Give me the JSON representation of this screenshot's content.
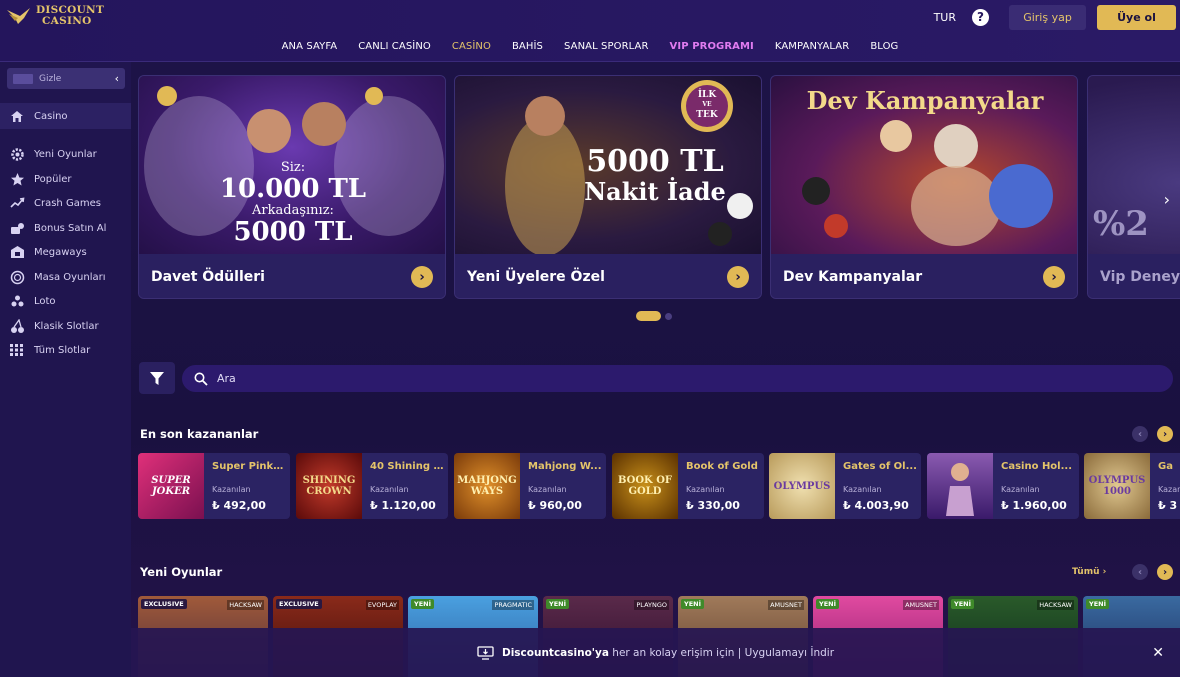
{
  "brand": {
    "line1": "DISCOUNT",
    "line2": "CASINO"
  },
  "header": {
    "lang": "TUR",
    "login": "Giriş yap",
    "register": "Üye ol",
    "nav": [
      "ANA SAYFA",
      "CANLI CASİNO",
      "CASİNO",
      "BAHİS",
      "SANAL SPORLAR",
      "VIP PROGRAMI",
      "KAMPANYALAR",
      "BLOG"
    ]
  },
  "sidebar": {
    "hide_label": "Gizle",
    "items": [
      {
        "label": "Casino",
        "icon": "home-icon"
      },
      {
        "label": "Yeni Oyunlar",
        "icon": "gear-icon"
      },
      {
        "label": "Popüler",
        "icon": "star-icon"
      },
      {
        "label": "Crash Games",
        "icon": "trend-icon"
      },
      {
        "label": "Bonus Satın Al",
        "icon": "bonus-icon"
      },
      {
        "label": "Megaways",
        "icon": "megaways-icon"
      },
      {
        "label": "Masa Oyunları",
        "icon": "table-icon"
      },
      {
        "label": "Loto",
        "icon": "lotto-icon"
      },
      {
        "label": "Klasik Slotlar",
        "icon": "cherry-icon"
      },
      {
        "label": "Tüm Slotlar",
        "icon": "grid-icon"
      }
    ]
  },
  "promos": [
    {
      "title": "Davet Ödülleri",
      "img_line1": "Siz:",
      "img_line2": "10.000 TL",
      "img_line3": "Arkadaşınız:",
      "img_line4": "5000 TL"
    },
    {
      "title": "Yeni Üyelere Özel",
      "img_line1": "5000 TL",
      "img_line2": "Nakit İade",
      "badge1": "İLK",
      "badge2": "VE",
      "badge3": "TEK"
    },
    {
      "title": "Dev Kampanyalar",
      "img_line1": "Dev Kampanyalar"
    },
    {
      "title": "Vip Deneyi",
      "img_line1": "%2"
    }
  ],
  "search": {
    "placeholder": "Ara"
  },
  "winners": {
    "title": "En son kazananlar",
    "label": "Kazanılan",
    "items": [
      {
        "name": "Super Pink ...",
        "amount": "₺ 492,00",
        "thumb": "SUPER JOKER",
        "color": "#c2185b"
      },
      {
        "name": "40 Shining ...",
        "amount": "₺ 1.120,00",
        "thumb": "SHINING CROWN",
        "color": "#8b1a1a"
      },
      {
        "name": "Mahjong W...",
        "amount": "₺ 960,00",
        "thumb": "MAHJONG WAYS",
        "color": "#b8650f"
      },
      {
        "name": "Book of Gold",
        "amount": "₺ 330,00",
        "thumb": "BOOK OF GOLD",
        "color": "#7a4a0a"
      },
      {
        "name": "Gates of Ol...",
        "amount": "₺ 4.003,90",
        "thumb": "OLYMPUS",
        "color": "#d9c28a"
      },
      {
        "name": "Casino Hol...",
        "amount": "₺ 1.960,00",
        "thumb": "",
        "color": "#5b3a7a"
      },
      {
        "name": "Ga",
        "amount": "₺ 3",
        "thumb": "OLYMPUS 1000",
        "color": "#b99a5a"
      }
    ]
  },
  "new_games": {
    "title": "Yeni Oyunlar",
    "all": "Tümü ›",
    "items": [
      {
        "tag": "EXCLUSIVE",
        "provider": "HACKSAW",
        "color": "#7a3a2a"
      },
      {
        "tag": "EXCLUSIVE",
        "provider": "EVOPLAY",
        "color": "#6a1a1a"
      },
      {
        "tag": "YENİ",
        "provider": "PRAGMATIC",
        "color": "#3a8acf"
      },
      {
        "tag": "YENİ",
        "provider": "PLAYNGO",
        "color": "#4a1a3a"
      },
      {
        "tag": "YENİ",
        "provider": "AMUSNET",
        "color": "#8a5a3a"
      },
      {
        "tag": "YENİ",
        "provider": "AMUSNET",
        "color": "#c23a8a"
      },
      {
        "tag": "YENİ",
        "provider": "HACKSAW",
        "color": "#1a4a2a"
      },
      {
        "tag": "YENİ",
        "provider": "",
        "color": "#3a5a8a"
      }
    ]
  },
  "app_bar": {
    "brand": "Discountcasino'ya",
    "text": " her an kolay erişim için | ",
    "link": "Uygulamayı İndir"
  }
}
